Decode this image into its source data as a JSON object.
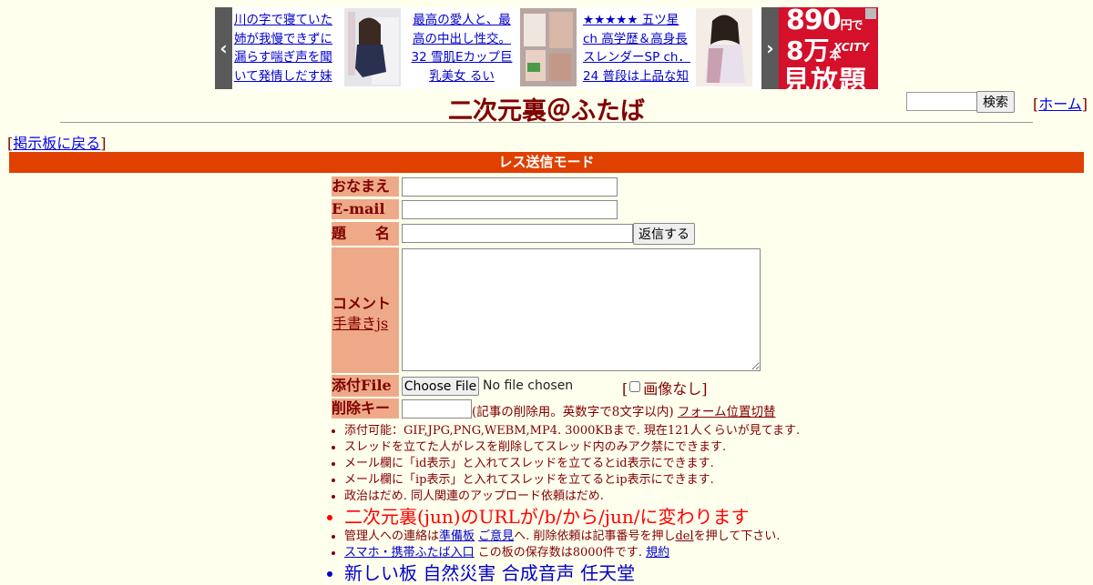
{
  "ads": {
    "items": [
      {
        "text": "川の字で寝ていた姉が我慢できずに漏らす喘ぎ声を聞いて発情しだす妹"
      },
      {
        "text": "最高の愛人と、最高の中出し性交。32 雪肌Eカップ巨乳美女 るい"
      },
      {
        "text": "★★★★★ 五ツ星ch 高学歴＆高身長スレンダーSP ch．24 普段は上品な知"
      }
    ],
    "banner": {
      "line1": "890",
      "line1_unit": "円で",
      "line2": "8万",
      "line2_unit": "本",
      "brand": "XCITY",
      "line3": "見放題"
    },
    "colors": {
      "banner": "#d4102a",
      "arrow": "#5a5a5a"
    }
  },
  "header": {
    "title": "二次元裏＠ふたば",
    "search_button": "検索",
    "home_link": "ホーム",
    "back_link": "掲示板に戻る"
  },
  "form": {
    "mode_title": "レス送信モード",
    "labels": {
      "name": "おなまえ",
      "email": "E-mail",
      "subject": "題　　名",
      "comment": "コメント",
      "handwriting": "手書きjs",
      "attach": "添付File",
      "delkey": "削除キー"
    },
    "submit_label": "返信する",
    "file_button": "Choose File",
    "file_status": "No file chosen",
    "no_image_label": "画像なし",
    "delkey_note": "(記事の削除用。英数字で8文字以内)",
    "form_position_link": "フォーム位置切替"
  },
  "notes": {
    "n1": "添付可能：GIF,JPG,PNG,WEBM,MP4. 3000KBまで. 現在121人くらいが見てます.",
    "n2": "スレッドを立てた人がレスを削除してスレッド内のみアク禁にできます.",
    "n3": "メール欄に「id表示」と入れてスレッドを立てるとid表示にできます.",
    "n4": "メール欄に「ip表示」と入れてスレッドを立てるとip表示にできます.",
    "n5": "政治はだめ. 同人関連のアップロード依頼はだめ.",
    "n6": "二次元裏(jun)のURLが/b/から/jun/に変わります",
    "n7_pre": "管理人への連絡は",
    "n7_link1": "準備板",
    "n7_link2": "ご意見",
    "n7_mid": "へ. 削除依頼は記事番号を押し",
    "n7_del": "del",
    "n7_post": "を押して下さい.",
    "n8_link": "スマホ・携帯ふたば入口",
    "n8_mid": " この板の保存数は8000件です. ",
    "n8_rules": "規約",
    "n9": "新しい板 自然災害 合成音声 任天堂"
  },
  "colors": {
    "background": "#ffffee",
    "text": "#800000",
    "mode_bar": "#e04000",
    "label_bg": "#eeaa88",
    "link": "#0000ee"
  }
}
